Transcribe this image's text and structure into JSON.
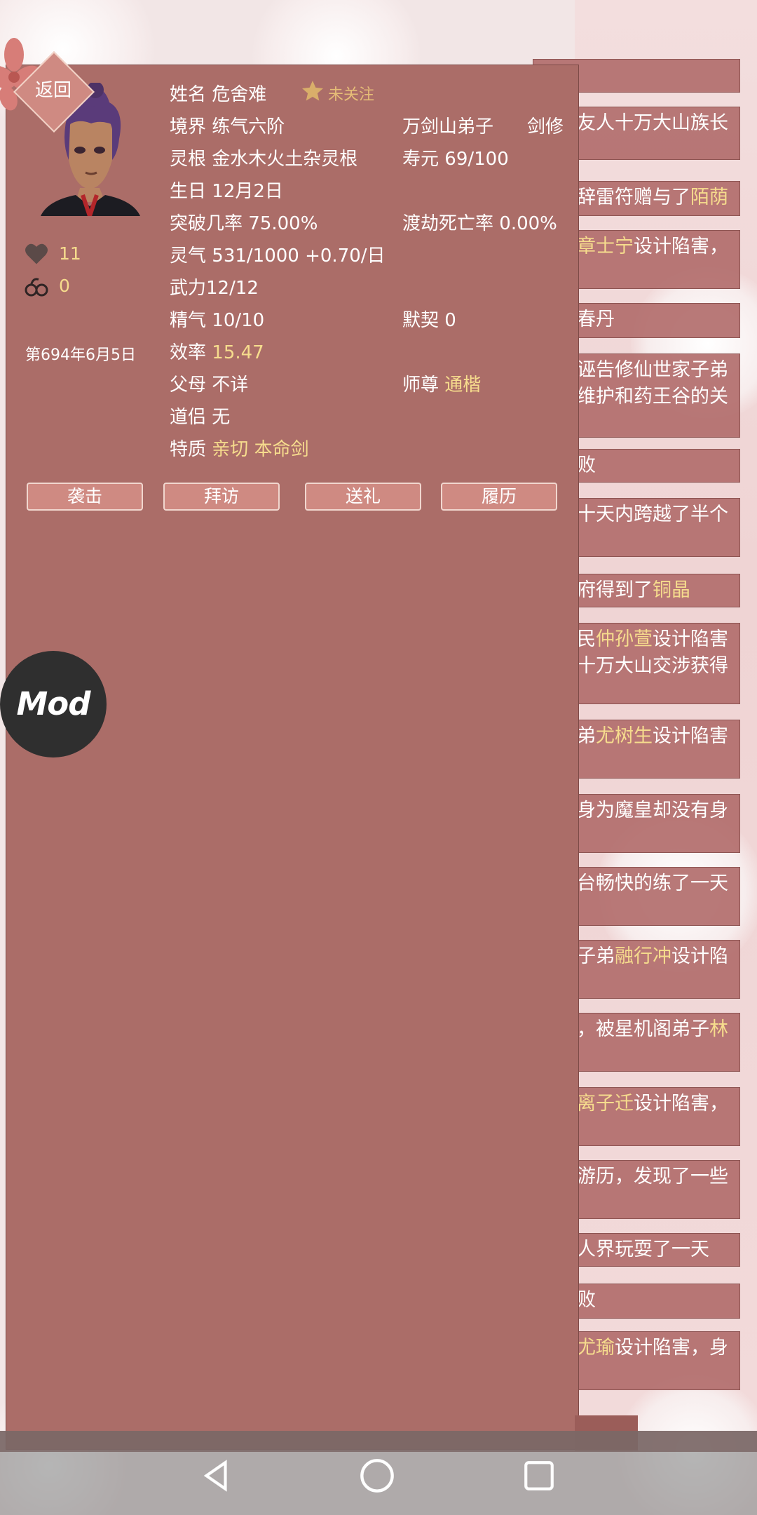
{
  "header": {
    "back_label": "返回",
    "follow_label": "未关注"
  },
  "profile": {
    "name_label": "姓名",
    "name": "危舍难",
    "realm_label": "境界",
    "realm": "练气六阶",
    "sect": "万剑山弟子",
    "profession": "剑修",
    "root_label": "灵根",
    "root": "金水木火土杂灵根",
    "lifespan_label": "寿元",
    "lifespan": "69/100",
    "birthday_label": "生日",
    "birthday": "12月2日",
    "breakthrough_label": "突破几率",
    "breakthrough": "75.00%",
    "tribulation_label": "渡劫死亡率",
    "tribulation": "0.00%",
    "qi_label": "灵气",
    "qi": "531/1000 +0.70/日",
    "force": "武力12/12",
    "essence_label": "精气",
    "essence": "10/10",
    "tacit_label": "默契",
    "tacit": "0",
    "efficiency_label": "效率",
    "efficiency": "15.47",
    "parents_label": "父母",
    "parents": "不详",
    "master_label": "师尊",
    "master": "通楷",
    "partner_label": "道侣",
    "partner": "无",
    "traits_label": "特质",
    "trait_1": "亲切",
    "trait_2": "本命剑"
  },
  "stats": {
    "hearts": "11",
    "chains": "0",
    "date": "第694年6月5日"
  },
  "actions": {
    "attack": "袭击",
    "visit": "拜访",
    "gift": "送礼",
    "history": "履历"
  },
  "mod_label": "Mod",
  "log": [
    {
      "text": "",
      "hl": ""
    },
    {
      "text": "友人十万大山族长",
      "hl": ""
    },
    {
      "text": "辞雷符赠与了",
      "hl": "陌荫"
    },
    {
      "text": "设计陷害，",
      "hl": "章士宁",
      "hl_first": true
    },
    {
      "text": "春丹",
      "hl": ""
    },
    {
      "text": "诬告修仙世家子弟\n维护和药王谷的关",
      "hl": ""
    },
    {
      "text": "败",
      "hl": ""
    },
    {
      "text": "十天内跨越了半个",
      "hl": ""
    },
    {
      "text": "府得到了",
      "hl": "铜晶"
    },
    {
      "text": "民",
      "hl": "仲孙萱",
      "tail": "设计陷害\n十万大山交涉获得"
    },
    {
      "text": "弟",
      "hl": "尤树生",
      "tail": "设计陷害"
    },
    {
      "text": "身为魔皇却没有身",
      "hl": ""
    },
    {
      "text": "台畅快的练了一天",
      "hl": ""
    },
    {
      "text": "子弟",
      "hl": "融行冲",
      "tail": "设计陷"
    },
    {
      "text": "，被星机阁弟子",
      "hl": "林"
    },
    {
      "text": "设计陷害，",
      "hl": "离子迁",
      "hl_first": true
    },
    {
      "text": "游历，发现了一些",
      "hl": ""
    },
    {
      "text": "人界玩耍了一天",
      "hl": ""
    },
    {
      "text": "败",
      "hl": ""
    },
    {
      "text": "设计陷害，身",
      "hl": "尤瑜",
      "hl_first": true
    }
  ],
  "colors": {
    "panel": "#ab6d68",
    "highlight": "#f6dc8d",
    "button": "#cf8a82"
  }
}
